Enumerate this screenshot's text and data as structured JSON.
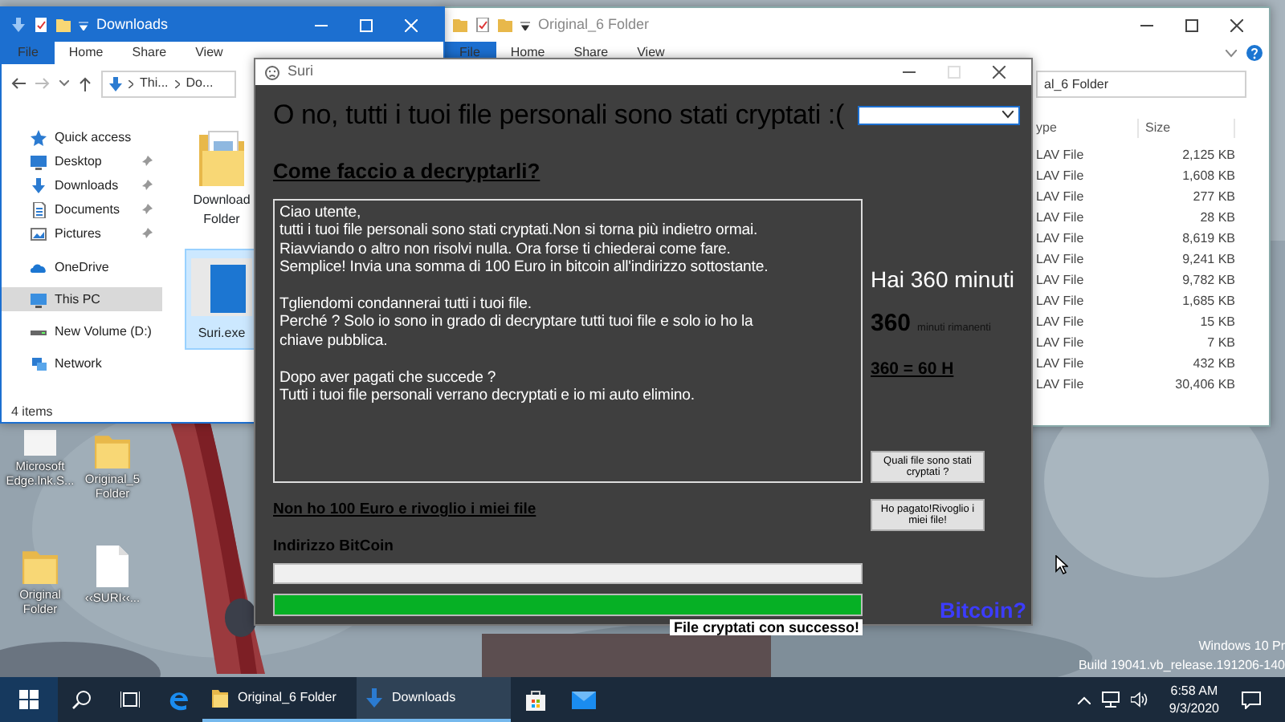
{
  "desktop": {
    "icons": [
      {
        "label": "Microsoft\nEdge.lnk.S...",
        "kind": "shortcut"
      },
      {
        "label": "Original_5\nFolder",
        "kind": "folder"
      },
      {
        "label": "Original\nFolder",
        "kind": "folder"
      },
      {
        "label": "‹‹SURI‹‹...",
        "kind": "file"
      }
    ],
    "watermark": [
      "Windows 10 Pr",
      "Build 19041.vb_release.191206-140"
    ]
  },
  "downloads_window": {
    "title": "Downloads",
    "active": true,
    "ribbon_tabs": [
      {
        "label": "File",
        "kind": "file"
      },
      {
        "label": "Home",
        "kind": "tab"
      },
      {
        "label": "Share",
        "kind": "tab"
      },
      {
        "label": "View",
        "kind": "tab"
      }
    ],
    "path": [
      "Thi...",
      "Do..."
    ],
    "sidebar": [
      {
        "label": "Quick access",
        "kind": "star",
        "pinned": false,
        "selected": false
      },
      {
        "label": "Desktop",
        "kind": "desktop",
        "pinned": true,
        "selected": false
      },
      {
        "label": "Downloads",
        "kind": "download",
        "pinned": true,
        "selected": false
      },
      {
        "label": "Documents",
        "kind": "document",
        "pinned": true,
        "selected": false
      },
      {
        "label": "Pictures",
        "kind": "pictures",
        "pinned": true,
        "selected": false
      },
      {
        "label": "OneDrive",
        "kind": "cloud",
        "pinned": false,
        "selected": false
      },
      {
        "label": "This PC",
        "kind": "pc",
        "pinned": false,
        "selected": true
      },
      {
        "label": "New Volume (D:)",
        "kind": "drive",
        "pinned": false,
        "selected": false
      },
      {
        "label": "Network",
        "kind": "network",
        "pinned": false,
        "selected": false
      }
    ],
    "files": [
      {
        "label": "Download\nFolder",
        "kind": "folder",
        "selected": false
      },
      {
        "label": "Suri.exe",
        "kind": "app",
        "selected": true
      }
    ],
    "status": "4 items"
  },
  "folder_window": {
    "title": "Original_6 Folder",
    "active": false,
    "ribbon_tabs": [
      {
        "label": "File",
        "kind": "file"
      },
      {
        "label": "Home",
        "kind": "tab"
      },
      {
        "label": "Share",
        "kind": "tab"
      },
      {
        "label": "View",
        "kind": "tab"
      }
    ],
    "path": "al_6 Folder",
    "columns": [
      "ype",
      "Size"
    ],
    "rows": [
      {
        "type": "LAV File",
        "size": "2,125 KB"
      },
      {
        "type": "LAV File",
        "size": "1,608 KB"
      },
      {
        "type": "LAV File",
        "size": "277 KB"
      },
      {
        "type": "LAV File",
        "size": "28 KB"
      },
      {
        "type": "LAV File",
        "size": "8,619 KB"
      },
      {
        "type": "LAV File",
        "size": "9,241 KB"
      },
      {
        "type": "LAV File",
        "size": "9,782 KB"
      },
      {
        "type": "LAV File",
        "size": "1,685 KB"
      },
      {
        "type": "LAV File",
        "size": "15 KB"
      },
      {
        "type": "LAV File",
        "size": "7 KB"
      },
      {
        "type": "LAV File",
        "size": "432 KB"
      },
      {
        "type": "LAV File",
        "size": "30,406 KB"
      }
    ]
  },
  "suri": {
    "title": "Suri",
    "heading": "O no, tutti i tuoi file personali sono stati cryptati :(",
    "subheading": "Come faccio a decryptarli?",
    "message": [
      "Ciao utente,\ntutti i tuoi file personali sono stati cryptati.Non si torna più indietro ormai.\nRiavviando o altro non risolvi nulla. Ora forse ti chiederai come fare.\nSemplice! Invia una somma di 100 Euro in bitcoin all'indirizzo sottostante.",
      "Tgliendomi condannerai tutti i tuoi file.\nPerché ? Solo io sono in grado di decryptare tutti tuoi file e solo io ho la\nchiave pubblica.",
      "Dopo aver pagati che succede ?\nTutti i tuoi file personali verrano decryptati e io mi auto elimino."
    ],
    "timer_title": "Hai 360 minuti",
    "timer_value": "360",
    "timer_unit": "minuti rimanenti",
    "timer_note": "360 = 60 H",
    "buttons": [
      "Quali file sono stati cryptati ?",
      "Ho pagato!Rivoglio i miei file!"
    ],
    "no_money_link": "Non ho 100 Euro e rivoglio i miei file",
    "address_label": "Indirizzo BitCoin",
    "progress": {
      "level": 1
    },
    "status": "File cryptati con successo!",
    "bitcoin_link": "Bitcoin?"
  },
  "taskbar": {
    "apps": [
      {
        "label": "Original_6 Folder",
        "kind": "folder",
        "active": false
      },
      {
        "label": "Downloads",
        "kind": "download",
        "active": true
      }
    ],
    "time": "6:58 AM",
    "date": "9/3/2020"
  }
}
